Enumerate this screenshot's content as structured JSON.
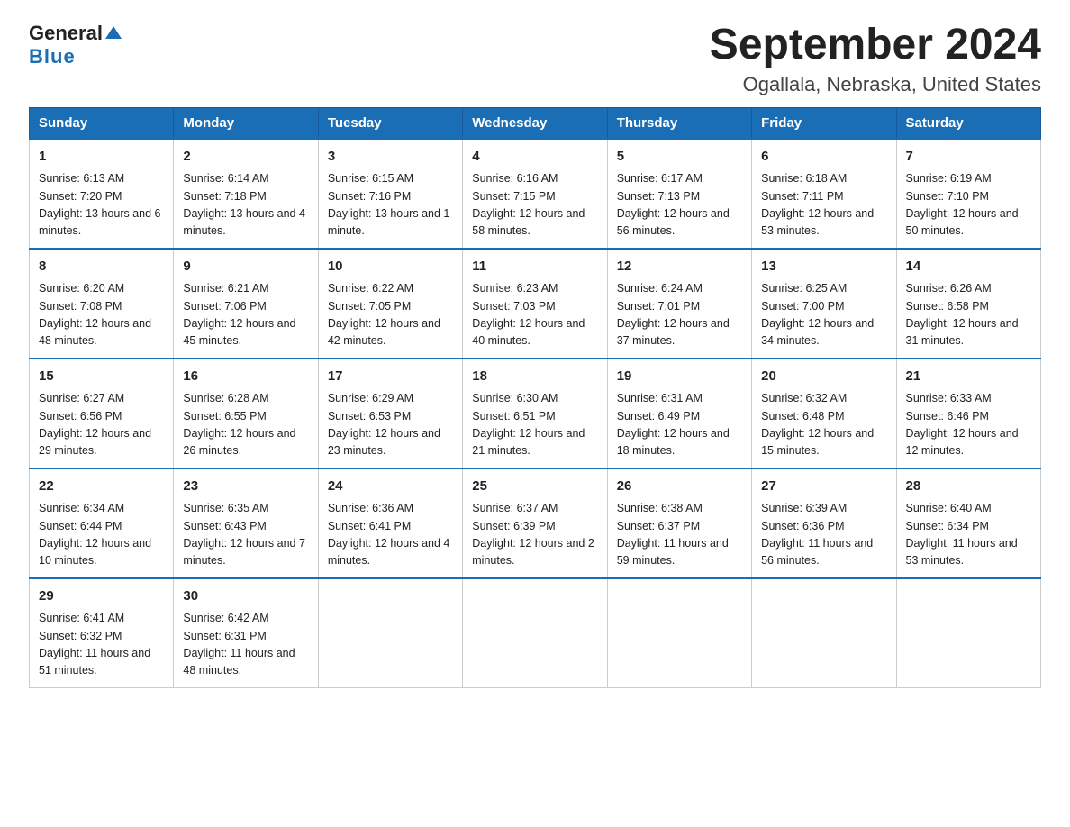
{
  "logo": {
    "part1": "General",
    "part2": "Blue"
  },
  "title": "September 2024",
  "subtitle": "Ogallala, Nebraska, United States",
  "days_of_week": [
    "Sunday",
    "Monday",
    "Tuesday",
    "Wednesday",
    "Thursday",
    "Friday",
    "Saturday"
  ],
  "weeks": [
    [
      {
        "num": "1",
        "sunrise": "6:13 AM",
        "sunset": "7:20 PM",
        "daylight": "13 hours and 6 minutes."
      },
      {
        "num": "2",
        "sunrise": "6:14 AM",
        "sunset": "7:18 PM",
        "daylight": "13 hours and 4 minutes."
      },
      {
        "num": "3",
        "sunrise": "6:15 AM",
        "sunset": "7:16 PM",
        "daylight": "13 hours and 1 minute."
      },
      {
        "num": "4",
        "sunrise": "6:16 AM",
        "sunset": "7:15 PM",
        "daylight": "12 hours and 58 minutes."
      },
      {
        "num": "5",
        "sunrise": "6:17 AM",
        "sunset": "7:13 PM",
        "daylight": "12 hours and 56 minutes."
      },
      {
        "num": "6",
        "sunrise": "6:18 AM",
        "sunset": "7:11 PM",
        "daylight": "12 hours and 53 minutes."
      },
      {
        "num": "7",
        "sunrise": "6:19 AM",
        "sunset": "7:10 PM",
        "daylight": "12 hours and 50 minutes."
      }
    ],
    [
      {
        "num": "8",
        "sunrise": "6:20 AM",
        "sunset": "7:08 PM",
        "daylight": "12 hours and 48 minutes."
      },
      {
        "num": "9",
        "sunrise": "6:21 AM",
        "sunset": "7:06 PM",
        "daylight": "12 hours and 45 minutes."
      },
      {
        "num": "10",
        "sunrise": "6:22 AM",
        "sunset": "7:05 PM",
        "daylight": "12 hours and 42 minutes."
      },
      {
        "num": "11",
        "sunrise": "6:23 AM",
        "sunset": "7:03 PM",
        "daylight": "12 hours and 40 minutes."
      },
      {
        "num": "12",
        "sunrise": "6:24 AM",
        "sunset": "7:01 PM",
        "daylight": "12 hours and 37 minutes."
      },
      {
        "num": "13",
        "sunrise": "6:25 AM",
        "sunset": "7:00 PM",
        "daylight": "12 hours and 34 minutes."
      },
      {
        "num": "14",
        "sunrise": "6:26 AM",
        "sunset": "6:58 PM",
        "daylight": "12 hours and 31 minutes."
      }
    ],
    [
      {
        "num": "15",
        "sunrise": "6:27 AM",
        "sunset": "6:56 PM",
        "daylight": "12 hours and 29 minutes."
      },
      {
        "num": "16",
        "sunrise": "6:28 AM",
        "sunset": "6:55 PM",
        "daylight": "12 hours and 26 minutes."
      },
      {
        "num": "17",
        "sunrise": "6:29 AM",
        "sunset": "6:53 PM",
        "daylight": "12 hours and 23 minutes."
      },
      {
        "num": "18",
        "sunrise": "6:30 AM",
        "sunset": "6:51 PM",
        "daylight": "12 hours and 21 minutes."
      },
      {
        "num": "19",
        "sunrise": "6:31 AM",
        "sunset": "6:49 PM",
        "daylight": "12 hours and 18 minutes."
      },
      {
        "num": "20",
        "sunrise": "6:32 AM",
        "sunset": "6:48 PM",
        "daylight": "12 hours and 15 minutes."
      },
      {
        "num": "21",
        "sunrise": "6:33 AM",
        "sunset": "6:46 PM",
        "daylight": "12 hours and 12 minutes."
      }
    ],
    [
      {
        "num": "22",
        "sunrise": "6:34 AM",
        "sunset": "6:44 PM",
        "daylight": "12 hours and 10 minutes."
      },
      {
        "num": "23",
        "sunrise": "6:35 AM",
        "sunset": "6:43 PM",
        "daylight": "12 hours and 7 minutes."
      },
      {
        "num": "24",
        "sunrise": "6:36 AM",
        "sunset": "6:41 PM",
        "daylight": "12 hours and 4 minutes."
      },
      {
        "num": "25",
        "sunrise": "6:37 AM",
        "sunset": "6:39 PM",
        "daylight": "12 hours and 2 minutes."
      },
      {
        "num": "26",
        "sunrise": "6:38 AM",
        "sunset": "6:37 PM",
        "daylight": "11 hours and 59 minutes."
      },
      {
        "num": "27",
        "sunrise": "6:39 AM",
        "sunset": "6:36 PM",
        "daylight": "11 hours and 56 minutes."
      },
      {
        "num": "28",
        "sunrise": "6:40 AM",
        "sunset": "6:34 PM",
        "daylight": "11 hours and 53 minutes."
      }
    ],
    [
      {
        "num": "29",
        "sunrise": "6:41 AM",
        "sunset": "6:32 PM",
        "daylight": "11 hours and 51 minutes."
      },
      {
        "num": "30",
        "sunrise": "6:42 AM",
        "sunset": "6:31 PM",
        "daylight": "11 hours and 48 minutes."
      },
      null,
      null,
      null,
      null,
      null
    ]
  ]
}
